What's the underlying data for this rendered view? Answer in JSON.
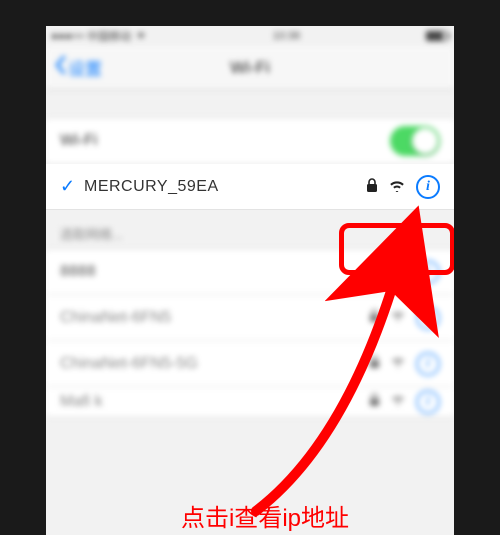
{
  "statusbar": {
    "carrier": "中国移动",
    "time": "10:36"
  },
  "nav": {
    "back": "设置",
    "title": "Wi-Fi"
  },
  "wifi_section": {
    "label": "Wi-Fi",
    "enabled": true
  },
  "connected": {
    "ssid": "MERCURY_59EA",
    "secured": true
  },
  "choose_label": "选取网络...",
  "networks": [
    {
      "ssid": "8888",
      "secured": true
    },
    {
      "ssid": "ChinaNet-6FN5",
      "secured": true
    },
    {
      "ssid": "ChinaNet-6FN5-5G",
      "secured": true
    },
    {
      "ssid": "Mafi k",
      "secured": true
    }
  ],
  "annotation": "点击i查看ip地址",
  "colors": {
    "accent": "#0a7bff",
    "highlight": "#ff0000",
    "toggle_on": "#4cd964"
  }
}
